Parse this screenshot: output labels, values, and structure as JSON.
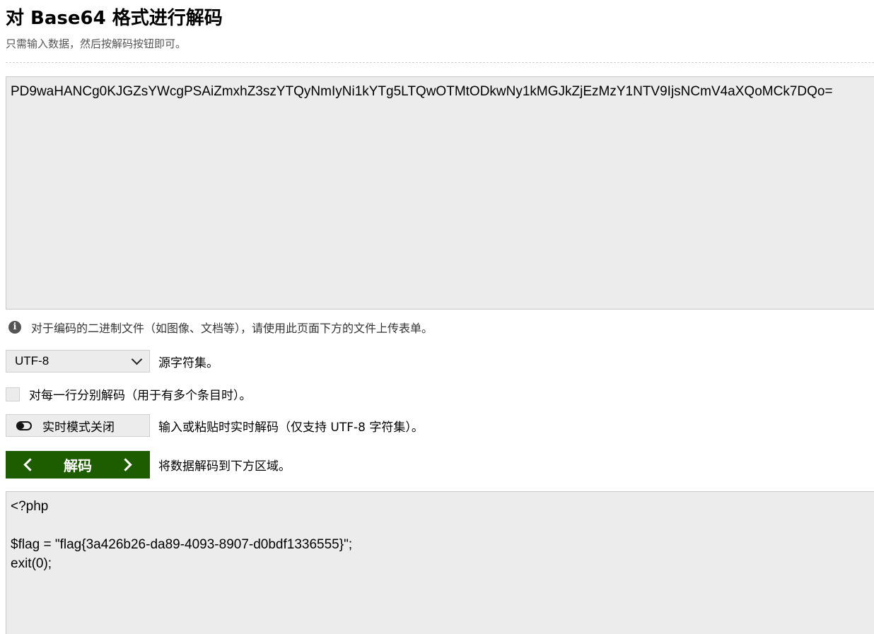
{
  "header": {
    "title": "对 Base64 格式进行解码",
    "subtitle": "只需输入数据，然后按解码按钮即可。"
  },
  "input": {
    "value": "PD9waHANCg0KJGZsYWcgPSAiZmxhZ3szYTQyNmIyNi1kYTg5LTQwOTMtODkwNy1kMGJkZjEzMzY1NTV9IjsNCmV4aXQoMCk7DQo="
  },
  "info": {
    "icon": "info-icon",
    "text": "对于编码的二进制文件（如图像、文档等），请使用此页面下方的文件上传表单。"
  },
  "charset": {
    "selected": "UTF-8",
    "label": "源字符集。"
  },
  "per_line": {
    "checked": false,
    "label": "对每一行分别解码（用于有多个条目时）。"
  },
  "live_mode": {
    "button_label": "实时模式关闭",
    "description": "输入或粘贴时实时解码（仅支持 UTF-8 字符集）。"
  },
  "decode": {
    "button_label": "解码",
    "description": "将数据解码到下方区域。"
  },
  "output": {
    "value": "<?php\n\n$flag = \"flag{3a426b26-da89-4093-8907-d0bdf1336555}\";\nexit(0);"
  },
  "colors": {
    "decode_button_bg": "#1e5c00",
    "textarea_bg": "#ececec"
  }
}
